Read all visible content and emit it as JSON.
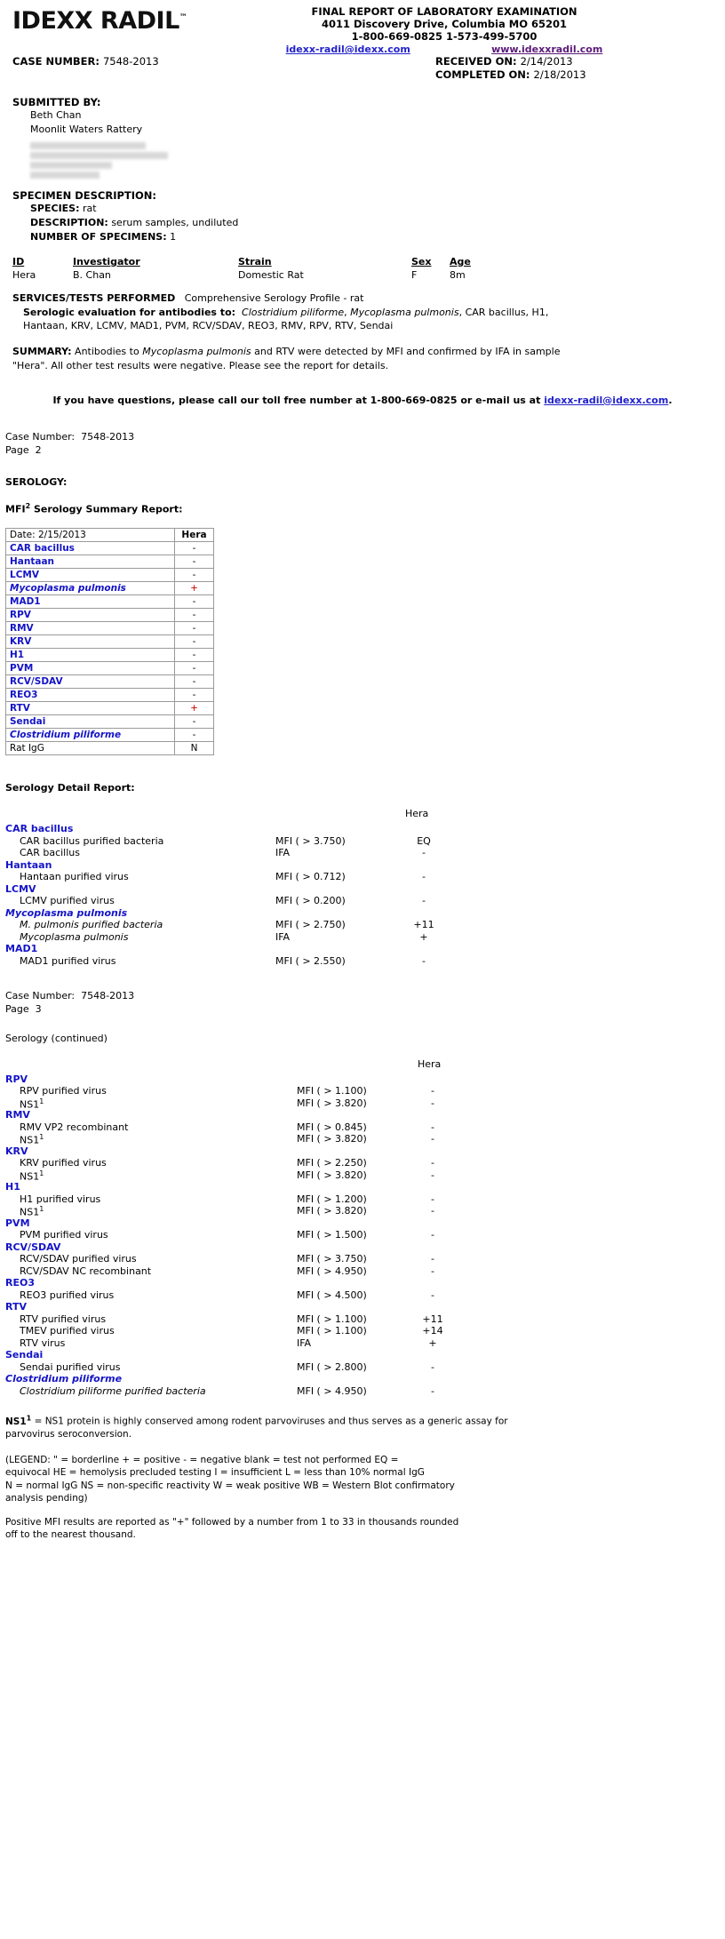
{
  "header": {
    "logo": "IDEXX RADIL",
    "logo_tm": "™",
    "title": "FINAL REPORT OF LABORATORY EXAMINATION",
    "address": "4011 Discovery Drive, Columbia MO 65201",
    "phones": "1-800-669-0825   1-573-499-5700",
    "email": "idexx-radil@idexx.com",
    "website": "www.idexxradil.com"
  },
  "case": {
    "case_number_label": "CASE NUMBER:",
    "case_number": "7548-2013",
    "received_label": "RECEIVED ON:",
    "received_on": "2/14/2013",
    "completed_label": "COMPLETED ON:",
    "completed_on": "2/18/2013"
  },
  "submitted_by": {
    "label": "SUBMITTED BY:",
    "name": "Beth Chan",
    "organization": "Moonlit Waters Rattery",
    "address_redacted": true
  },
  "specimen": {
    "label": "SPECIMEN DESCRIPTION:",
    "species_label": "SPECIES:",
    "species": "rat",
    "description_label": "DESCRIPTION:",
    "description": "serum samples, undiluted",
    "number_label": "NUMBER OF SPECIMENS:",
    "number": "1",
    "columns": [
      "ID",
      "Investigator",
      "Strain",
      "Sex",
      "Age"
    ],
    "rows": [
      {
        "id": "Hera",
        "investigator": "B. Chan",
        "strain": "Domestic Rat",
        "sex": "F",
        "age": "8m"
      }
    ]
  },
  "services": {
    "label": "SERVICES/TESTS PERFORMED",
    "value": "Comprehensive Serology Profile - rat",
    "serologic_label": "Serologic evaluation for antibodies to:",
    "agents_part1_italic_a": "Clostridium piliforme",
    "agents_sep1": ", ",
    "agents_part1_italic_b": "Mycoplasma pulmonis",
    "agents_rest": ", CAR bacillus, H1, Hantaan, KRV, LCMV, MAD1, PVM, RCV/SDAV, REO3, RMV, RPV, RTV, Sendai"
  },
  "summary": {
    "label": "SUMMARY:",
    "text_a": "Antibodies to ",
    "text_italic": "Mycoplasma pulmonis",
    "text_b": " and RTV were detected by MFI and confirmed by IFA in sample \"Hera\".  All other test results were negative.  Please see the report for details."
  },
  "contact_line": {
    "before": "If you have questions, please call our toll free number at 1-800-669-0825 or e-mail us at ",
    "email": "idexx-radil@idexx.com",
    "after": "."
  },
  "page2": {
    "case_label": "Case Number:",
    "case_number": "7548-2013",
    "page_label": "Page",
    "page_number": "2",
    "serology_heading": "SEROLOGY:",
    "mfi_title_a": "MFI",
    "mfi_title_sup": "2",
    "mfi_title_b": " Serology Summary Report:"
  },
  "mfi_table": {
    "date_label": "Date: 2/15/2013",
    "sample_header": "Hera",
    "rows": [
      {
        "agent": "CAR bacillus",
        "italic": false,
        "blue": true,
        "result": "-",
        "positive": false
      },
      {
        "agent": "Hantaan",
        "italic": false,
        "blue": true,
        "result": "-",
        "positive": false
      },
      {
        "agent": "LCMV",
        "italic": false,
        "blue": true,
        "result": "-",
        "positive": false
      },
      {
        "agent": "Mycoplasma pulmonis",
        "italic": true,
        "blue": true,
        "result": "+",
        "positive": true
      },
      {
        "agent": "MAD1",
        "italic": false,
        "blue": true,
        "result": "-",
        "positive": false
      },
      {
        "agent": "RPV",
        "italic": false,
        "blue": true,
        "result": "-",
        "positive": false
      },
      {
        "agent": "RMV",
        "italic": false,
        "blue": true,
        "result": "-",
        "positive": false
      },
      {
        "agent": "KRV",
        "italic": false,
        "blue": true,
        "result": "-",
        "positive": false
      },
      {
        "agent": "H1",
        "italic": false,
        "blue": true,
        "result": "-",
        "positive": false
      },
      {
        "agent": "PVM",
        "italic": false,
        "blue": true,
        "result": "-",
        "positive": false
      },
      {
        "agent": "RCV/SDAV",
        "italic": false,
        "blue": true,
        "result": "-",
        "positive": false
      },
      {
        "agent": "REO3",
        "italic": false,
        "blue": true,
        "result": "-",
        "positive": false
      },
      {
        "agent": "RTV",
        "italic": false,
        "blue": true,
        "result": "+",
        "positive": true
      },
      {
        "agent": "Sendai",
        "italic": false,
        "blue": true,
        "result": "-",
        "positive": false
      },
      {
        "agent": "Clostridium piliforme",
        "italic": true,
        "blue": true,
        "result": "-",
        "positive": false
      },
      {
        "agent": "Rat IgG",
        "italic": false,
        "blue": false,
        "result": "N",
        "positive": false
      }
    ]
  },
  "detail": {
    "title": "Serology Detail Report:",
    "column_header": "Hera",
    "groups": [
      {
        "name": "CAR bacillus",
        "italic": false,
        "tests": [
          {
            "test": "CAR bacillus purified bacteria",
            "italic": false,
            "method": "MFI ( > 3.750)",
            "result": "EQ"
          },
          {
            "test": "CAR bacillus",
            "italic": false,
            "method": "IFA",
            "result": "-"
          }
        ]
      },
      {
        "name": "Hantaan",
        "italic": false,
        "tests": [
          {
            "test": "Hantaan purified virus",
            "italic": false,
            "method": "MFI ( > 0.712)",
            "result": "-"
          }
        ]
      },
      {
        "name": "LCMV",
        "italic": false,
        "tests": [
          {
            "test": "LCMV purified virus",
            "italic": false,
            "method": "MFI ( > 0.200)",
            "result": "-"
          }
        ]
      },
      {
        "name": "Mycoplasma pulmonis",
        "italic": true,
        "tests": [
          {
            "test": "M. pulmonis purified bacteria",
            "italic": true,
            "method": "MFI ( > 2.750)",
            "result": "+11"
          },
          {
            "test": "Mycoplasma pulmonis",
            "italic": true,
            "method": "IFA",
            "result": "+"
          }
        ]
      },
      {
        "name": "MAD1",
        "italic": false,
        "tests": [
          {
            "test": "MAD1 purified virus",
            "italic": false,
            "method": "MFI ( > 2.550)",
            "result": "-"
          }
        ]
      }
    ]
  },
  "page3": {
    "case_label": "Case Number:",
    "case_number": "7548-2013",
    "page_label": "Page",
    "page_number": "3",
    "continued": "Serology (continued)",
    "column_header": "Hera",
    "groups": [
      {
        "name": "RPV",
        "italic": false,
        "tests": [
          {
            "test": "RPV purified virus",
            "sup": "",
            "method": "MFI ( > 1.100)",
            "result": "-"
          },
          {
            "test": "NS1",
            "sup": "1",
            "method": "MFI ( > 3.820)",
            "result": "-"
          }
        ]
      },
      {
        "name": "RMV",
        "italic": false,
        "tests": [
          {
            "test": "RMV VP2 recombinant",
            "sup": "",
            "method": "MFI ( > 0.845)",
            "result": "-"
          },
          {
            "test": "NS1",
            "sup": "1",
            "method": "MFI ( > 3.820)",
            "result": "-"
          }
        ]
      },
      {
        "name": "KRV",
        "italic": false,
        "tests": [
          {
            "test": "KRV purified virus",
            "sup": "",
            "method": "MFI ( > 2.250)",
            "result": "-"
          },
          {
            "test": "NS1",
            "sup": "1",
            "method": "MFI ( > 3.820)",
            "result": "-"
          }
        ]
      },
      {
        "name": "H1",
        "italic": false,
        "tests": [
          {
            "test": "H1 purified virus",
            "sup": "",
            "method": "MFI ( > 1.200)",
            "result": "-"
          },
          {
            "test": "NS1",
            "sup": "1",
            "method": "MFI ( > 3.820)",
            "result": "-"
          }
        ]
      },
      {
        "name": "PVM",
        "italic": false,
        "tests": [
          {
            "test": "PVM purified virus",
            "sup": "",
            "method": "MFI ( > 1.500)",
            "result": "-"
          }
        ]
      },
      {
        "name": "RCV/SDAV",
        "italic": false,
        "tests": [
          {
            "test": "RCV/SDAV purified virus",
            "sup": "",
            "method": "MFI ( > 3.750)",
            "result": "-"
          },
          {
            "test": "RCV/SDAV NC recombinant",
            "sup": "",
            "method": "MFI ( > 4.950)",
            "result": "-"
          }
        ]
      },
      {
        "name": "REO3",
        "italic": false,
        "tests": [
          {
            "test": "REO3 purified virus",
            "sup": "",
            "method": "MFI ( > 4.500)",
            "result": "-"
          }
        ]
      },
      {
        "name": "RTV",
        "italic": false,
        "tests": [
          {
            "test": "RTV purified virus",
            "sup": "",
            "method": "MFI ( > 1.100)",
            "result": "+11"
          },
          {
            "test": "TMEV purified virus",
            "sup": "",
            "method": "MFI ( > 1.100)",
            "result": "+14"
          },
          {
            "test": "RTV virus",
            "sup": "",
            "method": "IFA",
            "result": "+"
          }
        ]
      },
      {
        "name": "Sendai",
        "italic": false,
        "tests": [
          {
            "test": "Sendai purified virus",
            "sup": "",
            "method": "MFI ( > 2.800)",
            "result": "-"
          }
        ]
      },
      {
        "name": "Clostridium piliforme",
        "italic": true,
        "tests": [
          {
            "test": "Clostridium piliforme purified bacteria",
            "italic": true,
            "sup": "",
            "method": "MFI ( > 4.950)",
            "result": "-"
          }
        ]
      }
    ]
  },
  "footnotes": {
    "ns1_sup": "1",
    "ns1_text": " = NS1 protein is highly conserved among rodent parvoviruses and thus serves as a generic assay for parvovirus seroconversion.",
    "ns1_prefix": "NS1",
    "legend_line1": "(LEGEND:  \" = borderline   + = positive   - = negative   blank = test not performed   EQ =",
    "legend_line2": "equivocal   HE = hemolysis precluded testing   I = insufficient   L = less than 10% normal IgG",
    "legend_line3": "N = normal IgG   NS = non-specific reactivity   W = weak positive   WB = Western Blot confirmatory",
    "legend_line4": "analysis pending)",
    "posnote_line1": "Positive MFI results are reported as \"+\" followed by a number from 1 to 33 in thousands rounded",
    "posnote_line2": "off to the nearest thousand."
  }
}
